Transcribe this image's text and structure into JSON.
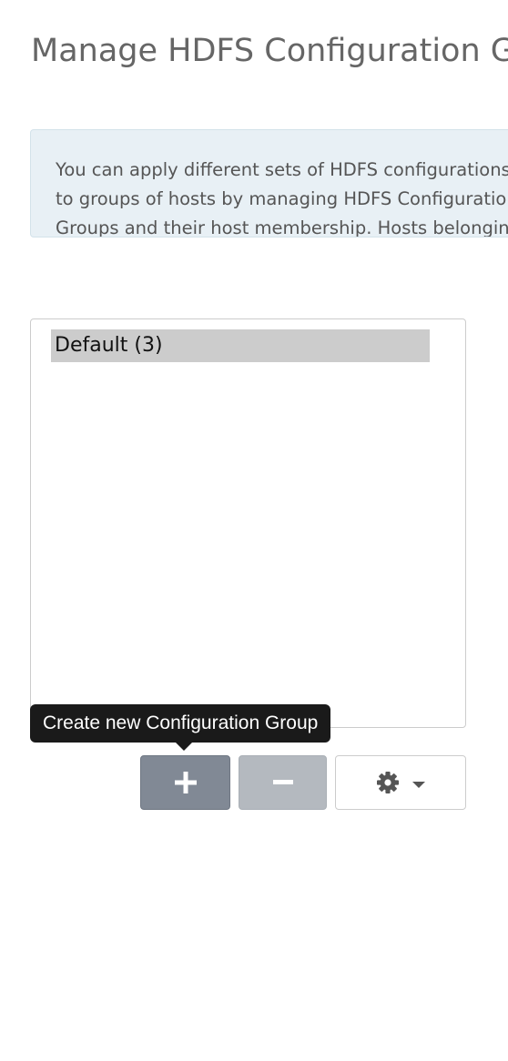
{
  "page": {
    "title": "Manage HDFS Configuration Groups"
  },
  "info": {
    "text": "You can apply different sets of HDFS configurations to groups of hosts by managing HDFS Configuration Groups and their host membership. Hosts belonging to a HDFS Configuration Group have the same set of configurations."
  },
  "group_list": {
    "items": [
      {
        "label": "Default (3)",
        "selected": true
      }
    ]
  },
  "tooltip": {
    "text": "Create new Configuration Group"
  },
  "toolbar": {
    "add_icon": "plus-icon",
    "remove_icon": "minus-icon",
    "settings_icon": "gear-icon",
    "dropdown_icon": "caret-down-icon"
  },
  "colors": {
    "add_button": "#818995",
    "remove_button": "#b4b9bf",
    "info_background": "#e8f0f5",
    "selected_item": "#cccccc",
    "tooltip_background": "#1a1a1a"
  }
}
